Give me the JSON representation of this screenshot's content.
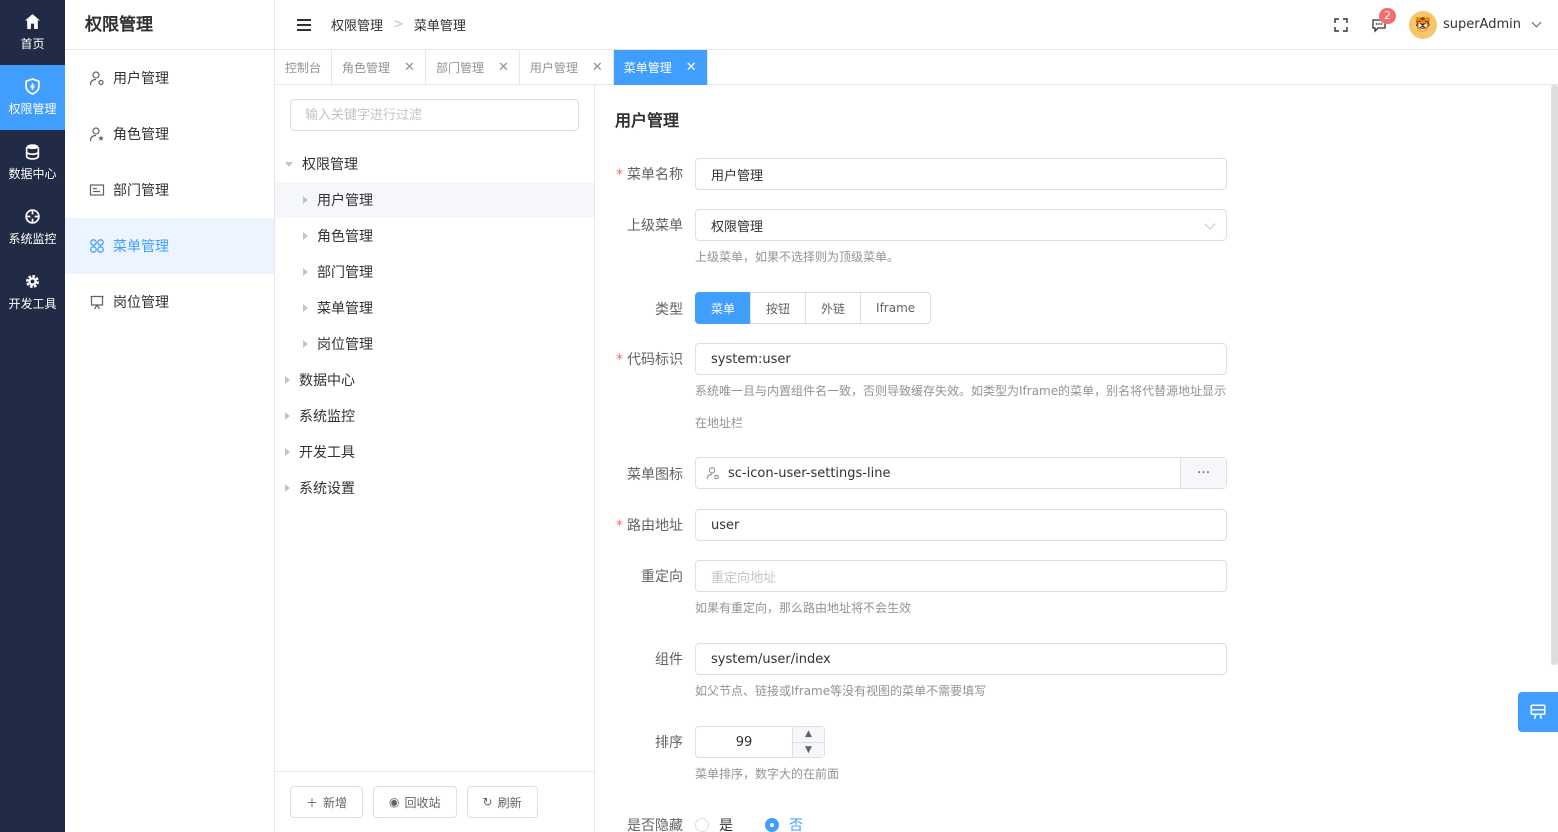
{
  "rail": [
    {
      "label": "首页",
      "icon": "home-icon",
      "active": false
    },
    {
      "label": "权限管理",
      "icon": "shield-icon",
      "active": true
    },
    {
      "label": "数据中心",
      "icon": "database-icon",
      "active": false
    },
    {
      "label": "系统监控",
      "icon": "crosshair-icon",
      "active": false
    },
    {
      "label": "开发工具",
      "icon": "gear-icon",
      "active": false
    }
  ],
  "sidebar": {
    "title": "权限管理",
    "items": [
      {
        "label": "用户管理",
        "icon": "user-settings-icon"
      },
      {
        "label": "角色管理",
        "icon": "user-star-icon"
      },
      {
        "label": "部门管理",
        "icon": "id-card-icon"
      },
      {
        "label": "菜单管理",
        "icon": "apps-icon"
      },
      {
        "label": "岗位管理",
        "icon": "presentation-icon"
      }
    ]
  },
  "header": {
    "breadcrumb": [
      "权限管理",
      "菜单管理"
    ],
    "notification_count": "2",
    "username": "superAdmin"
  },
  "tabs": [
    {
      "label": "控制台",
      "closable": false
    },
    {
      "label": "角色管理",
      "closable": true
    },
    {
      "label": "部门管理",
      "closable": true
    },
    {
      "label": "用户管理",
      "closable": true
    },
    {
      "label": "菜单管理",
      "closable": true,
      "active": true
    }
  ],
  "tree": {
    "filter_placeholder": "输入关键字进行过滤",
    "nodes": [
      {
        "label": "权限管理",
        "level": 0,
        "expanded": true
      },
      {
        "label": "用户管理",
        "level": 1,
        "selected": true
      },
      {
        "label": "角色管理",
        "level": 1
      },
      {
        "label": "部门管理",
        "level": 1
      },
      {
        "label": "菜单管理",
        "level": 1
      },
      {
        "label": "岗位管理",
        "level": 1
      },
      {
        "label": "数据中心",
        "level": 0
      },
      {
        "label": "系统监控",
        "level": 0
      },
      {
        "label": "开发工具",
        "level": 0
      },
      {
        "label": "系统设置",
        "level": 0
      }
    ],
    "buttons": {
      "add": "新增",
      "recycle": "回收站",
      "refresh": "刷新"
    }
  },
  "form": {
    "title": "用户管理",
    "name_label": "菜单名称",
    "name_value": "用户管理",
    "parent_label": "上级菜单",
    "parent_value": "权限管理",
    "parent_hint": "上级菜单，如果不选择则为顶级菜单。",
    "type_label": "类型",
    "type_options": [
      "菜单",
      "按钮",
      "外链",
      "Iframe"
    ],
    "code_label": "代码标识",
    "code_value": "system:user",
    "code_hint_1": "系统唯一且与内置组件名一致，否则导致缓存失效。如类型为Iframe的菜单，别名将代替源地址显示",
    "code_hint_2": "在地址栏",
    "icon_label": "菜单图标",
    "icon_value": "sc-icon-user-settings-line",
    "path_label": "路由地址",
    "path_value": "user",
    "redirect_label": "重定向",
    "redirect_placeholder": "重定向地址",
    "redirect_hint": "如果有重定向，那么路由地址将不会生效",
    "component_label": "组件",
    "component_value": "system/user/index",
    "component_hint": "如父节点、链接或Iframe等没有视图的菜单不需要填写",
    "sort_label": "排序",
    "sort_value": "99",
    "sort_hint": "菜单排序，数字大的在前面",
    "hidden_label": "是否隐藏",
    "hidden_yes": "是",
    "hidden_no": "否"
  },
  "colors": {
    "primary": "#409eff",
    "rail": "#222b45",
    "danger": "#f56c6c"
  }
}
